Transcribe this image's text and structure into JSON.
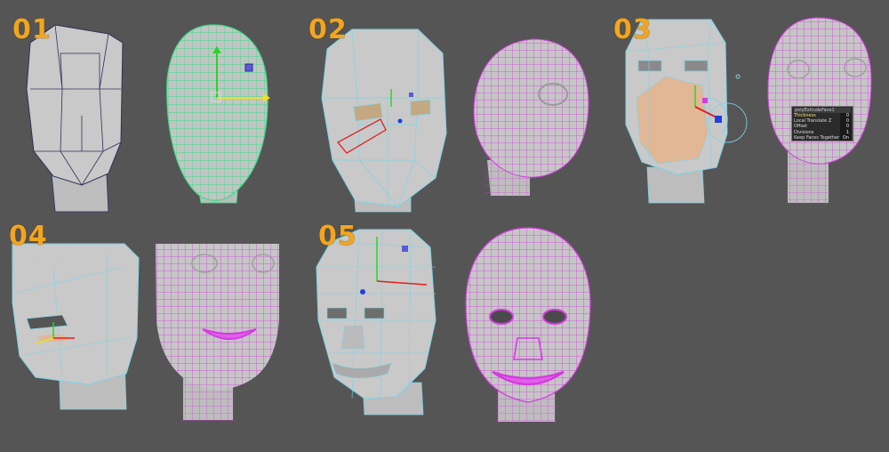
{
  "steps": [
    {
      "number": "01"
    },
    {
      "number": "02"
    },
    {
      "number": "03"
    },
    {
      "number": "04"
    },
    {
      "number": "05"
    }
  ],
  "attribute_box": {
    "title": "polyExtrudeFace1",
    "rows": [
      {
        "label": "Thickness",
        "value": "0"
      },
      {
        "label": "Local Translate Z",
        "value": "0"
      },
      {
        "label": "Offset",
        "value": "0"
      },
      {
        "label": "Divisions",
        "value": "1"
      },
      {
        "label": "Keep Faces Together",
        "value": "On"
      }
    ]
  },
  "colors": {
    "background": "#555555",
    "step_number": "#f2a51e",
    "wire_green": "#3ddc8a",
    "wire_magenta": "#d43be0",
    "wire_cyan": "#7fd4e6",
    "mesh_gray": "#c6c6c6"
  }
}
